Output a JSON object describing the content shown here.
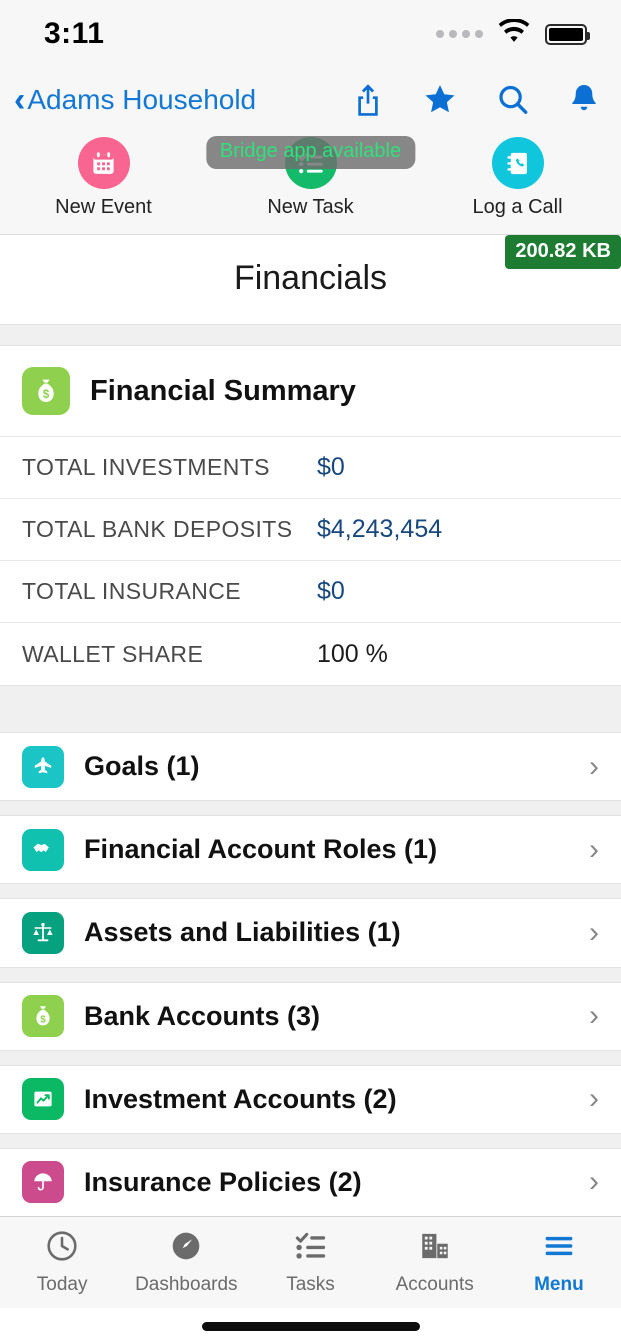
{
  "status_bar": {
    "time": "3:11",
    "signal_icon": "signal-dots-icon",
    "wifi_icon": "wifi-icon",
    "battery_icon": "battery-full-icon"
  },
  "nav_bar": {
    "back_chevron": "‹",
    "back_label": "Adams Household",
    "actions": [
      {
        "name": "share-icon",
        "label": "Share"
      },
      {
        "name": "favorite-star-icon",
        "label": "Favorite"
      },
      {
        "name": "search-icon",
        "label": "Search"
      },
      {
        "name": "notifications-bell-icon",
        "label": "Notifications"
      }
    ],
    "accent_color": "#1278d4"
  },
  "toast": {
    "message": "Bridge app available",
    "text_color": "#2fe17a",
    "background": "rgba(110,110,110,0.82)"
  },
  "quick_actions": [
    {
      "label": "New Event",
      "icon": "calendar-icon",
      "color": "#f96591"
    },
    {
      "label": "New Task",
      "icon": "task-checklist-icon",
      "color": "#13ba6a"
    },
    {
      "label": "Log a Call",
      "icon": "phone-book-icon",
      "color": "#0fc6dd"
    }
  ],
  "page": {
    "title": "Financials"
  },
  "size_badge": {
    "text": "200.82 KB",
    "color": "#1e7b32"
  },
  "financial_summary": {
    "title": "Financial Summary",
    "icon": "money-bag-icon",
    "icon_color": "#8fd14f",
    "rows": [
      {
        "label": "TOTAL INVESTMENTS",
        "value": "$0",
        "style": "link"
      },
      {
        "label": "TOTAL BANK DEPOSITS",
        "value": "$4,243,454",
        "style": "link"
      },
      {
        "label": "TOTAL INSURANCE",
        "value": "$0",
        "style": "link"
      },
      {
        "label": "WALLET SHARE",
        "value": "100 %",
        "style": "plain"
      }
    ]
  },
  "related_lists": [
    {
      "label": "Goals (1)",
      "icon": "airplane-goal-icon",
      "color": "#1bc5c5",
      "arrow": "›"
    },
    {
      "label": "Financial Account Roles (1)",
      "icon": "handshake-icon",
      "color": "#0fc1ae",
      "arrow": "›"
    },
    {
      "label": "Assets and Liabilities (1)",
      "icon": "scales-balance-icon",
      "color": "#06a17e",
      "arrow": "›"
    },
    {
      "label": "Bank Accounts (3)",
      "icon": "money-bag-icon",
      "color": "#8fd14f",
      "arrow": "›"
    },
    {
      "label": "Investment Accounts (2)",
      "icon": "trend-chart-icon",
      "color": "#0bb964",
      "arrow": "›"
    },
    {
      "label": "Insurance Policies (2)",
      "icon": "umbrella-icon",
      "color": "#cc4b8d",
      "arrow": "›"
    }
  ],
  "tab_bar": {
    "active_color": "#1278d4",
    "inactive_color": "#6b6b6b",
    "items": [
      {
        "label": "Today",
        "icon": "clock-icon",
        "active": false
      },
      {
        "label": "Dashboards",
        "icon": "gauge-icon",
        "active": false
      },
      {
        "label": "Tasks",
        "icon": "checklist-icon",
        "active": false
      },
      {
        "label": "Accounts",
        "icon": "buildings-icon",
        "active": false
      },
      {
        "label": "Menu",
        "icon": "hamburger-menu-icon",
        "active": true
      }
    ]
  }
}
